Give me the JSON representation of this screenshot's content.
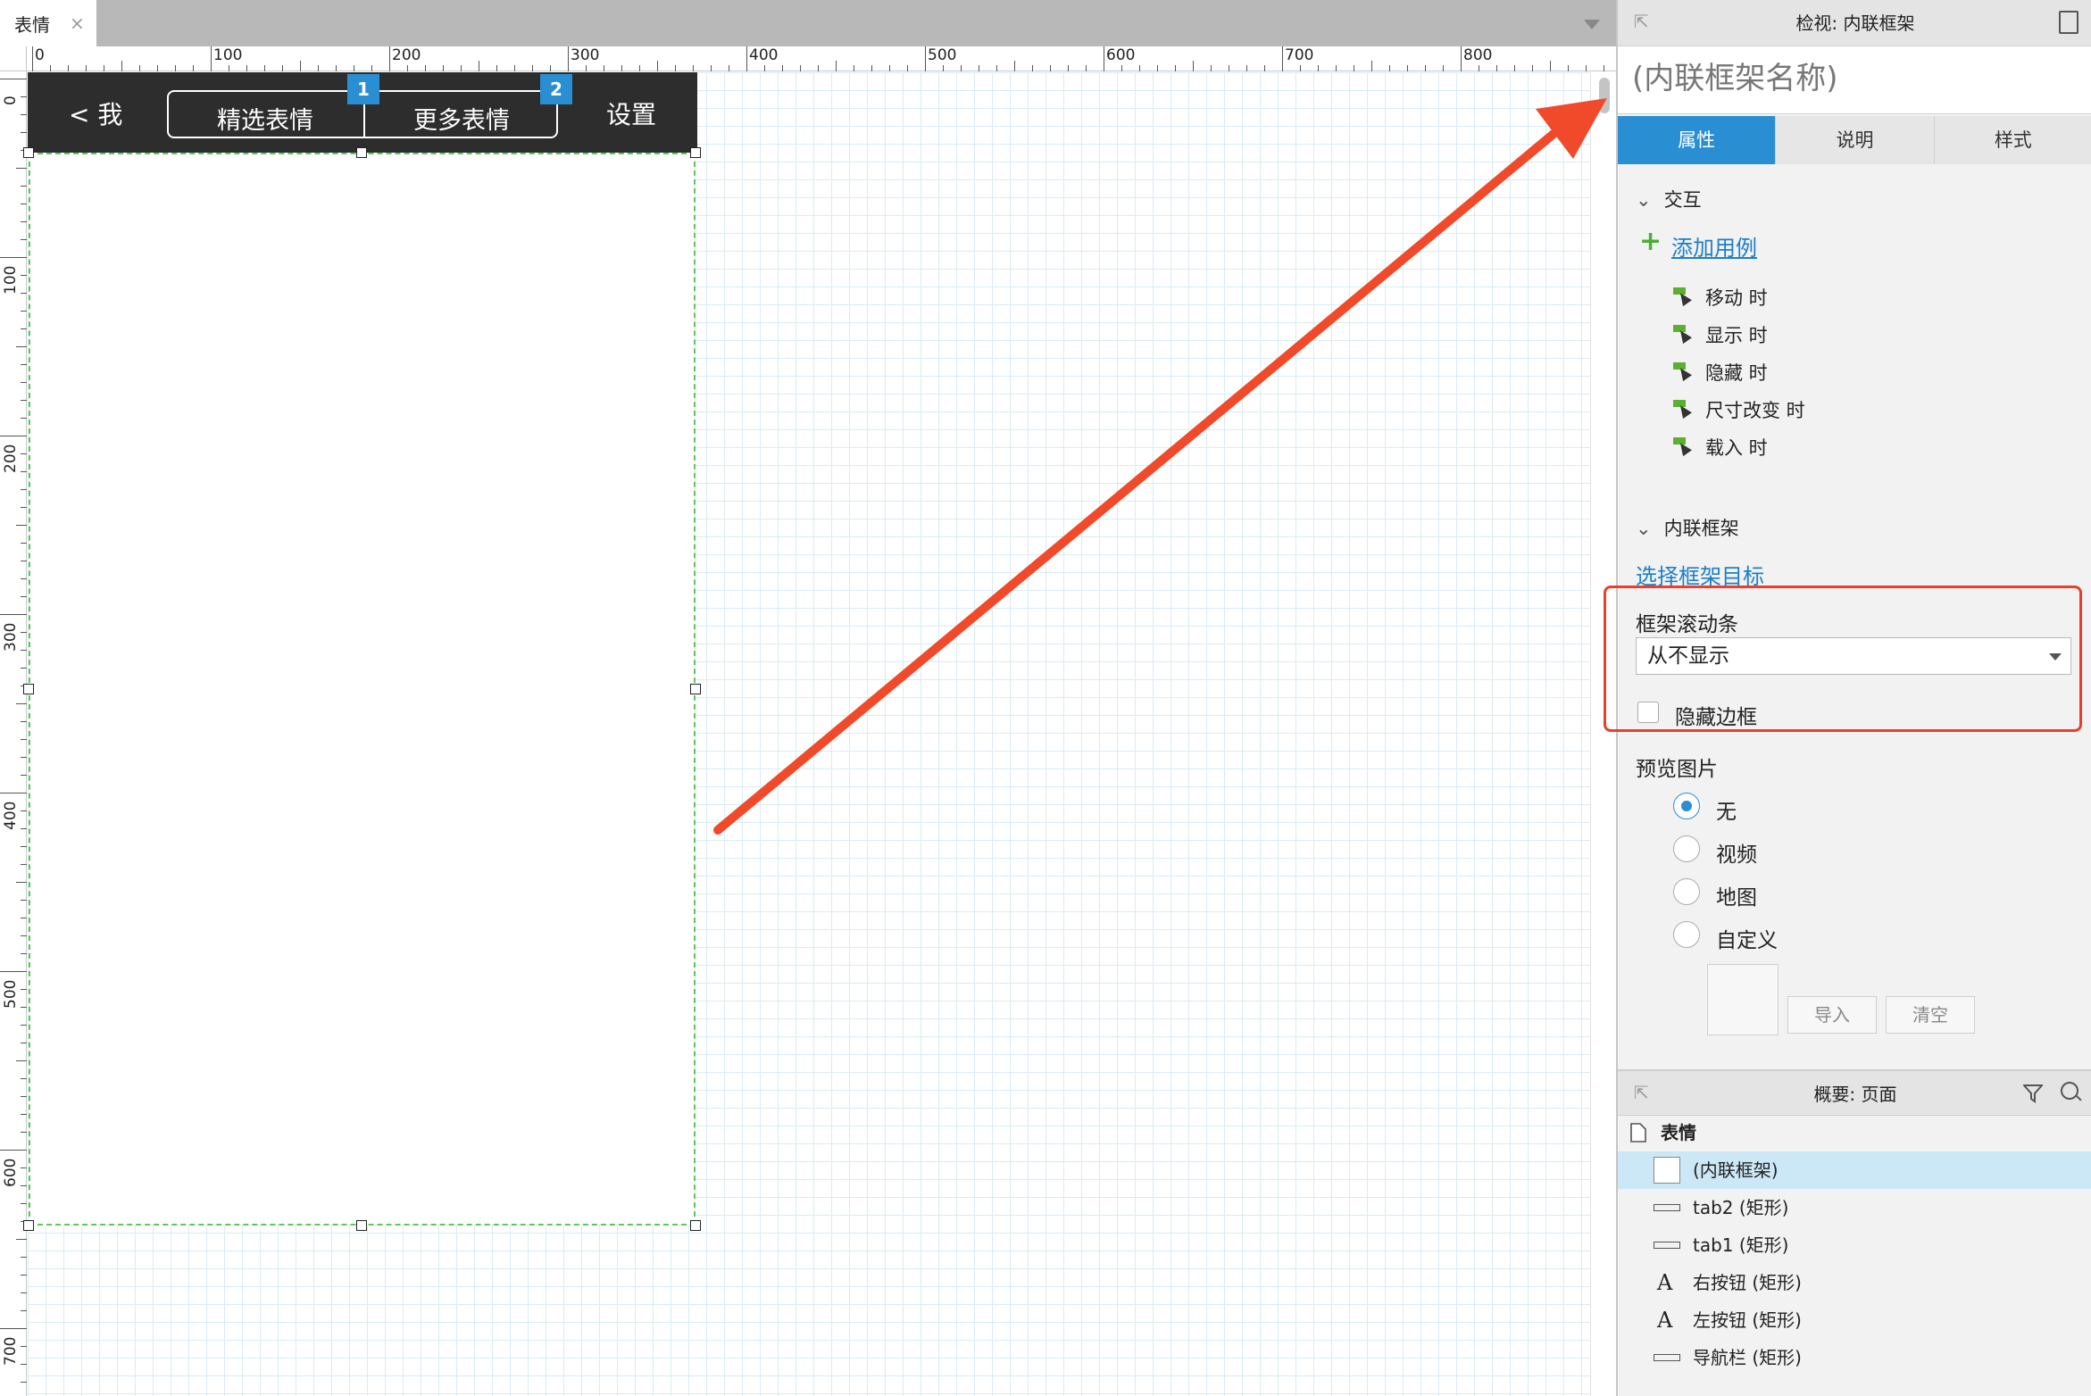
{
  "document_tab": {
    "title": "表情",
    "close": "×"
  },
  "ruler": {
    "h_labels": [
      "0",
      "100",
      "200",
      "300",
      "400",
      "500",
      "600",
      "700",
      "800"
    ],
    "v_labels": [
      "0",
      "100",
      "200",
      "300",
      "400",
      "500",
      "600",
      "700"
    ]
  },
  "prototype": {
    "back": "< 我",
    "settings": "设置",
    "segment1": "精选表情",
    "segment2": "更多表情",
    "badge1": "1",
    "badge2": "2"
  },
  "inspector": {
    "title": "检视: 内联框架",
    "name_placeholder": "(内联框架名称)",
    "tabs": [
      {
        "label": "属性",
        "active": true
      },
      {
        "label": "说明",
        "active": false
      },
      {
        "label": "样式",
        "active": false
      }
    ],
    "interaction": {
      "title": "交互",
      "add_case": "添加用例",
      "events": [
        "移动 时",
        "显示 时",
        "隐藏 时",
        "尺寸改变 时",
        "载入 时"
      ]
    },
    "inline_frame": {
      "title": "内联框架",
      "select_target": "选择框架目标",
      "scrollbar_label": "框架滚动条",
      "scrollbar_value": "从不显示",
      "hide_border": "隐藏边框",
      "preview_label": "预览图片",
      "preview_options": [
        {
          "label": "无",
          "checked": true
        },
        {
          "label": "视频",
          "checked": false
        },
        {
          "label": "地图",
          "checked": false
        },
        {
          "label": "自定义",
          "checked": false
        }
      ],
      "import": "导入",
      "clear": "清空"
    }
  },
  "outline": {
    "title": "概要: 页面",
    "page": "表情",
    "items": [
      {
        "label": "(内联框架)",
        "icon": "frame",
        "selected": true
      },
      {
        "label": "tab2 (矩形)",
        "icon": "rect",
        "selected": false
      },
      {
        "label": "tab1 (矩形)",
        "icon": "rect",
        "selected": false
      },
      {
        "label": "右按钮 (矩形)",
        "icon": "text",
        "selected": false
      },
      {
        "label": "左按钮 (矩形)",
        "icon": "text",
        "selected": false
      },
      {
        "label": "导航栏 (矩形)",
        "icon": "rect",
        "selected": false
      }
    ]
  },
  "colors": {
    "accent": "#2a8fd2",
    "highlight_red": "#e8402f",
    "arrow": "#f04a2a",
    "frame_border": "#5ac85a"
  }
}
